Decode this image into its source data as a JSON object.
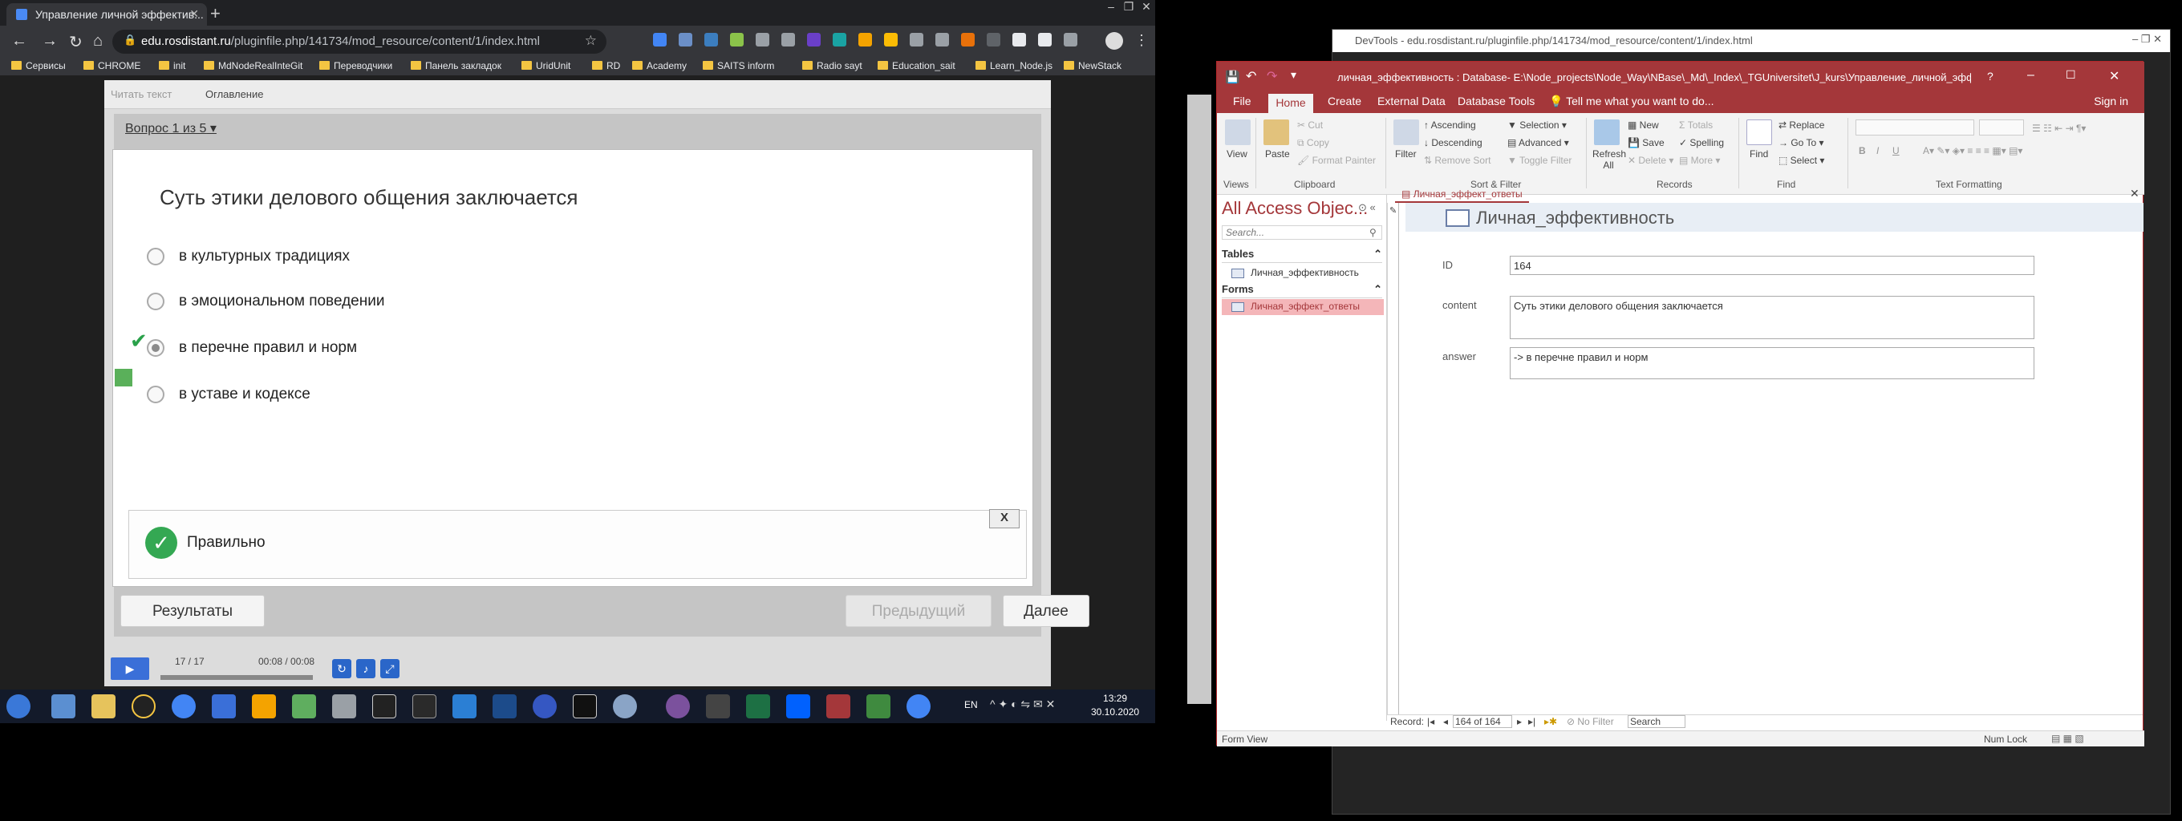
{
  "browser": {
    "tab_title": "Управление личной эффектив...",
    "url_domain": "edu.rosdistant.ru",
    "url_path": "/pluginfile.php/141734/mod_resource/content/1/index.html",
    "bookmarks": [
      "Сервисы",
      "CHROME",
      "init",
      "MdNodeRealInteGit",
      "Переводчики",
      "Панель закладок",
      "UridUnit",
      "RD",
      "Academy",
      "SAITS inform",
      "Radio sayt",
      "Education_sait",
      "Learn_Node.js",
      "NewStack"
    ]
  },
  "player": {
    "read_text": "Читать текст",
    "toc": "Оглавление",
    "question_nav": "Вопрос 1 из 5",
    "question": "Суть этики делового общения заключается",
    "options": [
      "в культурных традициях",
      "в эмоциональном поведении",
      "в перечне правил и норм",
      "в уставе и кодексе"
    ],
    "selected_index": 2,
    "feedback": "Правильно",
    "feedback_close": "X",
    "results_btn": "Результаты",
    "prev_btn": "Предыдущий",
    "next_btn": "Далее",
    "slide_counter": "17 / 17",
    "time": "00:08 / 00:08",
    "progress": 1.0
  },
  "taskbar": {
    "lang": "EN",
    "time": "13:29",
    "date": "30.10.2020"
  },
  "devtools": {
    "title": "DevTools - edu.rosdistant.ru/pluginfile.php/141734/mod_resource/content/1/index.html"
  },
  "access": {
    "title": "личная_эффективность : Database- E:\\Node_projects\\Node_Way\\NBase\\_Md\\_Index\\_TGUniversitet\\J_kurs\\Управление_личной_эффективностью\\_...",
    "help": "?",
    "tabs": [
      "File",
      "Home",
      "Create",
      "External Data",
      "Database Tools"
    ],
    "tell_me": "Tell me what you want to do...",
    "sign_in": "Sign in",
    "ribbon": {
      "view": "View",
      "paste": "Paste",
      "cut": "Cut",
      "copy": "Copy",
      "format_painter": "Format Painter",
      "filter": "Filter",
      "ascending": "Ascending",
      "descending": "Descending",
      "remove_sort": "Remove Sort",
      "selection": "Selection",
      "advanced": "Advanced",
      "toggle_filter": "Toggle Filter",
      "refresh_all": "Refresh All",
      "new": "New",
      "save": "Save",
      "delete": "Delete",
      "totals": "Totals",
      "spelling": "Spelling",
      "more": "More",
      "find": "Find",
      "replace": "Replace",
      "goto": "Go To",
      "select": "Select",
      "groups": [
        "Views",
        "Clipboard",
        "Sort & Filter",
        "Records",
        "Find",
        "Text Formatting"
      ]
    },
    "nav": {
      "title": "All Access Objec...",
      "search_placeholder": "Search...",
      "tables_label": "Tables",
      "table_item": "Личная_эффективность",
      "forms_label": "Forms",
      "form_item": "Личная_эффект_ответы"
    },
    "form_tab": "Личная_эффект_ответы",
    "form_header": "Личная_эффективность",
    "fields": {
      "id_label": "ID",
      "id_value": "164",
      "content_label": "content",
      "content_value": "Суть этики делового общения заключается",
      "answer_label": "answer",
      "answer_value": "-> в перечне правил и норм"
    },
    "record": {
      "label": "Record:",
      "position": "164 of 164",
      "no_filter": "No Filter",
      "search": "Search"
    },
    "status_left": "Form View",
    "status_right": "Num Lock"
  },
  "colors": {
    "access_red": "#a4373a",
    "correct_green": "#34a853",
    "player_blue": "#3a6fd8"
  }
}
